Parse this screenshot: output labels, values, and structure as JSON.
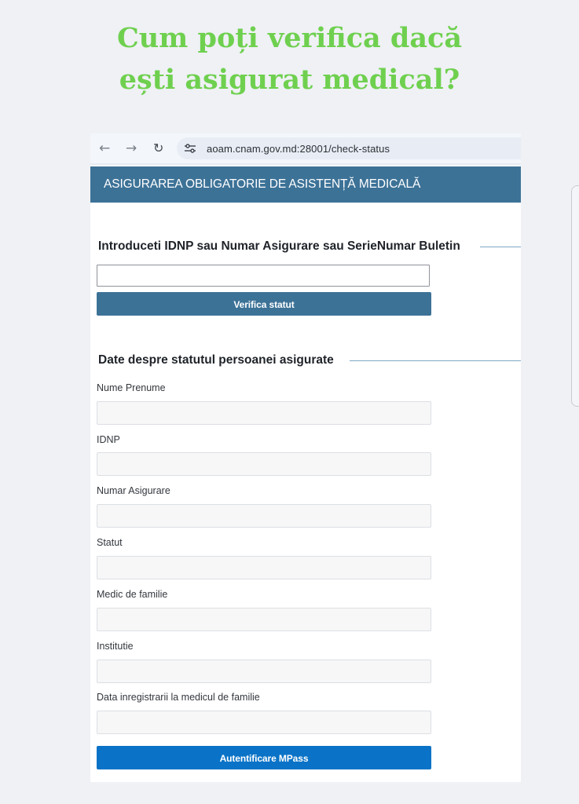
{
  "headline": {
    "line1": "Cum poți verifica dacă",
    "line2": "ești asigurat medical?",
    "color": "#6fd04f"
  },
  "browser": {
    "back_icon": "arrow-left-icon",
    "forward_icon": "arrow-right-icon",
    "reload_icon": "reload-icon",
    "site_settings_icon": "tune-icon",
    "url": "aoam.cnam.gov.md:28001/check-status"
  },
  "app": {
    "header_title": "ASIGURAREA OBLIGATORIE DE ASISTENȚĂ MEDICALĂ",
    "header_color": "#3d7297"
  },
  "search": {
    "section_title": "Introduceti IDNP sau Numar Asigurare sau SerieNumar Buletin",
    "input_value": "",
    "button_label": "Verifica statut"
  },
  "status": {
    "section_title": "Date despre statutul persoanei asigurate",
    "fields": [
      {
        "label": "Nume Prenume",
        "value": ""
      },
      {
        "label": "IDNP",
        "value": ""
      },
      {
        "label": "Numar Asigurare",
        "value": ""
      },
      {
        "label": "Statut",
        "value": ""
      },
      {
        "label": "Medic de familie",
        "value": ""
      },
      {
        "label": "Institutie",
        "value": ""
      },
      {
        "label": "Data inregistrarii la medicul de familie",
        "value": ""
      }
    ],
    "mpass_button_label": "Autentificare MPass",
    "mpass_color": "#0a73c7"
  }
}
